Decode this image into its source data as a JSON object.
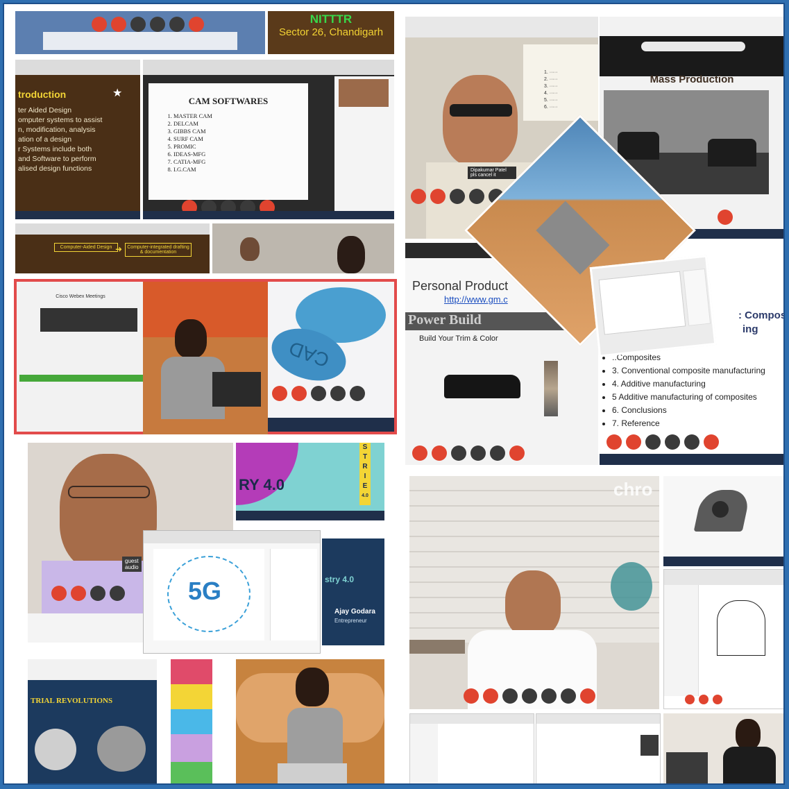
{
  "nitttr": {
    "title": "NITTTR",
    "subtitle": "Sector 26, Chandigarh"
  },
  "cad_slide": {
    "heading": "troduction",
    "lines": [
      "ter Aided Design",
      "omputer systems to assist",
      "n, modification, analysis",
      "ation of a design",
      "r  Systems  include  both",
      " and Software to perform",
      "alised design functions"
    ]
  },
  "cam_slide": {
    "title": "CAM SOFTWARES",
    "items": [
      "MASTER CAM",
      "DELCAM",
      "GIBBS CAM",
      "SURF CAM",
      "PROMIC",
      "IDEAS-MFG",
      "CATIA-MFG",
      "I.G.CAM"
    ]
  },
  "flow_slide": {
    "box1": "Computer-Aided Design",
    "box2": "Computer-integrated drafting & documentation"
  },
  "webex": {
    "title": "Cisco Webex Meetings"
  },
  "keychain": {
    "text": "CAD"
  },
  "mass_production": {
    "title": "Mass Production"
  },
  "personal_production": {
    "title": "Personal Product",
    "link": "http://www.gm.c"
  },
  "build_slide": {
    "banner": "Power Build",
    "subtitle": "Build Your Trim & Color"
  },
  "outline": {
    "partial_heading": ": Compos",
    "partial_heading2": "ing",
    "items": [
      "..Composites",
      "3. Conventional composite manufacturing",
      "4. Additive manufacturing",
      "5 Additive manufacturing of composites",
      "6. Conclusions",
      "7. Reference"
    ]
  },
  "participant_tag": {
    "name": "Dipakumar Patel",
    "note": "pls cancel it"
  },
  "industry_slide": {
    "text": "RY 4.0",
    "vertical": [
      "S",
      "T",
      "R",
      "I",
      "E",
      "4.0"
    ]
  },
  "fiveg": {
    "label": "5G"
  },
  "ajay": {
    "title": "stry 4.0",
    "name": "Ajay Godara",
    "role": "Entrepreneur"
  },
  "revolutions": {
    "title": "TRIAL REVOLUTIONS"
  },
  "chrome_label": "chro",
  "audio_tag": {
    "line1": "guest",
    "line2": "audio"
  },
  "colors": {
    "frame_blue": "#2f6fb0",
    "end_call_red": "#e0442f",
    "slide_navy": "#1c3a5e",
    "nitttr_brown": "#5a3a1a"
  }
}
